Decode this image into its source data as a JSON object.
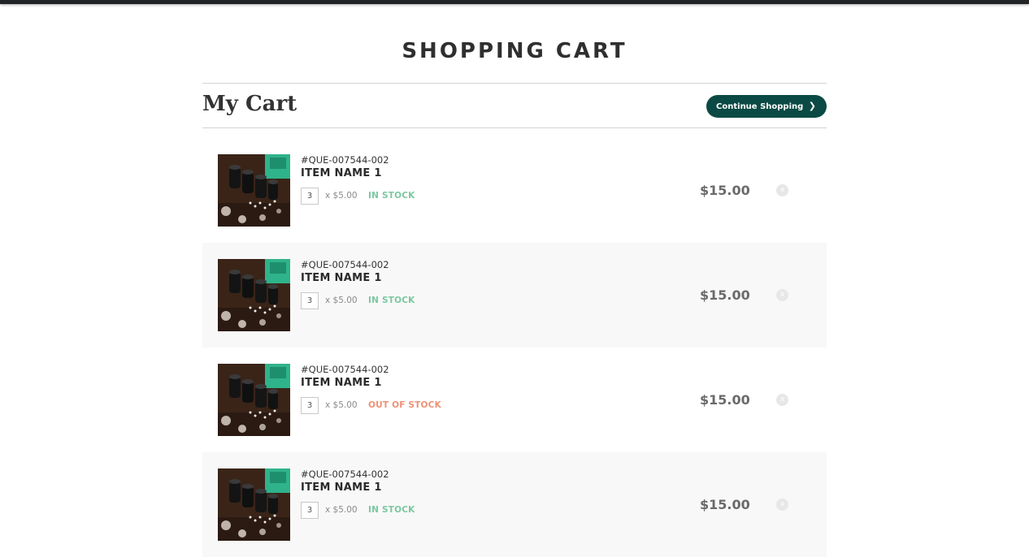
{
  "page": {
    "title": "SHOPPING CART"
  },
  "cart": {
    "heading": "My Cart",
    "continue_label": "Continue Shopping",
    "continue_icon": "chevron-right-icon"
  },
  "items": [
    {
      "sku": "#QUE-007544-002",
      "name": "ITEM NAME 1",
      "qty": "3",
      "unit_price": "x $5.00",
      "stock": "IN STOCK",
      "total": "$15.00",
      "remove": "x"
    },
    {
      "sku": "#QUE-007544-002",
      "name": "ITEM NAME 1",
      "qty": "3",
      "unit_price": "x $5.00",
      "stock": "IN STOCK",
      "total": "$15.00",
      "remove": "x"
    },
    {
      "sku": "#QUE-007544-002",
      "name": "ITEM NAME 1",
      "qty": "3",
      "unit_price": "x $5.00",
      "stock": "OUT OF STOCK",
      "total": "$15.00",
      "remove": "x"
    },
    {
      "sku": "#QUE-007544-002",
      "name": "ITEM NAME 1",
      "qty": "3",
      "unit_price": "x $5.00",
      "stock": "IN STOCK",
      "total": "$15.00",
      "remove": "x"
    }
  ],
  "colors": {
    "accent": "#0b4a44",
    "in_stock": "#7cc7a0",
    "out_of_stock": "#ee9174",
    "row_shade": "#f8f8f8"
  }
}
